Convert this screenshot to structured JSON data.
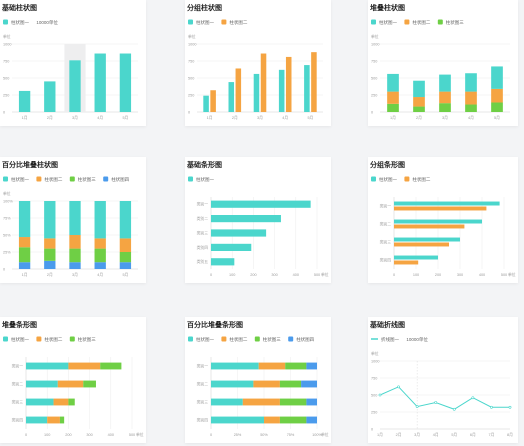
{
  "colors": {
    "teal": "#4bd6cc",
    "orange": "#f5a442",
    "green": "#6fcf45",
    "blue": "#4b9bec",
    "grid": "#ececec",
    "axis": "#cfcfcf",
    "text": "#9a9a9a",
    "highlight": "#eeeeef"
  },
  "chart_data": [
    {
      "id": "c1",
      "type": "bar",
      "title": "基础柱状图",
      "legend": [
        "柱状图一"
      ],
      "legend_note": "10000单位",
      "unit": "单位",
      "yticks": [
        "1000",
        "750",
        "500",
        "250",
        "0"
      ],
      "ymax": 1000,
      "categories": [
        "1月",
        "2月",
        "3月",
        "4月",
        "5月"
      ],
      "highlight_index": 2,
      "series": [
        {
          "name": "柱状图一",
          "color": "teal",
          "values": [
            310,
            450,
            760,
            860,
            860
          ]
        }
      ]
    },
    {
      "id": "c2",
      "type": "bar",
      "title": "分组柱状图",
      "legend": [
        "柱状图一",
        "柱状图二"
      ],
      "unit": "单位",
      "yticks": [
        "1000",
        "750",
        "500",
        "250",
        "0"
      ],
      "ymax": 1000,
      "categories": [
        "1月",
        "2月",
        "3月",
        "4月",
        "5月"
      ],
      "series": [
        {
          "name": "柱状图一",
          "color": "teal",
          "values": [
            240,
            440,
            560,
            620,
            690
          ]
        },
        {
          "name": "柱状图二",
          "color": "orange",
          "values": [
            320,
            640,
            860,
            810,
            880
          ]
        }
      ]
    },
    {
      "id": "c3",
      "type": "stacked-bar",
      "title": "堆叠柱状图",
      "legend": [
        "柱状图一",
        "柱状图二",
        "柱状图三"
      ],
      "unit": "单位",
      "yticks": [
        "1000",
        "750",
        "500",
        "250",
        "0"
      ],
      "ymax": 1000,
      "categories": [
        "1月",
        "2月",
        "3月",
        "4月",
        "5月"
      ],
      "series": [
        {
          "name": "柱状图三",
          "color": "green",
          "values": [
            120,
            80,
            130,
            110,
            140
          ]
        },
        {
          "name": "柱状图二",
          "color": "orange",
          "values": [
            180,
            140,
            170,
            190,
            200
          ]
        },
        {
          "name": "柱状图一",
          "color": "teal",
          "values": [
            260,
            240,
            250,
            270,
            330
          ]
        }
      ]
    },
    {
      "id": "c4",
      "type": "stacked-bar",
      "title": "百分比堆叠柱状图",
      "legend": [
        "柱状图一",
        "柱状图二",
        "柱状图三",
        "柱状图四"
      ],
      "unit": "单位",
      "yticks": [
        "100%",
        "75%",
        "50%",
        "25%",
        "0"
      ],
      "ymax": 100,
      "categories": [
        "1月",
        "2月",
        "3月",
        "4月",
        "5月"
      ],
      "series": [
        {
          "name": "柱状图四",
          "color": "blue",
          "values": [
            10,
            12,
            10,
            10,
            10
          ]
        },
        {
          "name": "柱状图三",
          "color": "green",
          "values": [
            22,
            18,
            20,
            20,
            15
          ]
        },
        {
          "name": "柱状图二",
          "color": "orange",
          "values": [
            15,
            15,
            20,
            15,
            20
          ]
        },
        {
          "name": "柱状图一",
          "color": "teal",
          "values": [
            53,
            55,
            50,
            55,
            55
          ]
        }
      ]
    },
    {
      "id": "c5",
      "type": "hbar",
      "title": "基础条形图",
      "legend": [
        "柱状图一"
      ],
      "unit": "单位",
      "xticks": [
        "0",
        "100",
        "200",
        "300",
        "400",
        "500"
      ],
      "xmax": 500,
      "categories": [
        "类别一",
        "类别二",
        "类别三",
        "类别四",
        "类别五"
      ],
      "series": [
        {
          "name": "柱状图一",
          "color": "teal",
          "values": [
            470,
            330,
            260,
            190,
            110
          ]
        }
      ]
    },
    {
      "id": "c6",
      "type": "hbar",
      "title": "分组条形图",
      "legend": [
        "柱状图一",
        "柱状图二"
      ],
      "unit": "单位",
      "xticks": [
        "0",
        "100",
        "200",
        "300",
        "400",
        "500"
      ],
      "xmax": 500,
      "categories": [
        "类别一",
        "类别二",
        "类别三",
        "类别四"
      ],
      "series": [
        {
          "name": "柱状图一",
          "color": "teal",
          "values": [
            480,
            400,
            300,
            200
          ]
        },
        {
          "name": "柱状图二",
          "color": "orange",
          "values": [
            420,
            320,
            250,
            110
          ]
        }
      ]
    },
    {
      "id": "c7",
      "type": "stacked-hbar",
      "title": "堆叠条形图",
      "legend": [
        "柱状图一",
        "柱状图二",
        "柱状图三"
      ],
      "unit": "单位",
      "xticks": [
        "0",
        "100",
        "200",
        "300",
        "400",
        "500"
      ],
      "xmax": 500,
      "categories": [
        "类别一",
        "类别二",
        "类别三",
        "类别四"
      ],
      "series": [
        {
          "name": "柱状图一",
          "color": "teal",
          "values": [
            200,
            150,
            130,
            100
          ]
        },
        {
          "name": "柱状图二",
          "color": "orange",
          "values": [
            150,
            120,
            70,
            60
          ]
        },
        {
          "name": "柱状图三",
          "color": "green",
          "values": [
            100,
            60,
            30,
            20
          ]
        }
      ]
    },
    {
      "id": "c8",
      "type": "stacked-hbar",
      "title": "百分比堆叠条形图",
      "legend": [
        "柱状图一",
        "柱状图二",
        "柱状图三",
        "柱状图四"
      ],
      "unit": "单位",
      "xticks": [
        "0",
        "25%",
        "50%",
        "75%",
        "100%"
      ],
      "xmax": 100,
      "categories": [
        "类别一",
        "类别二",
        "类别三",
        "类别四"
      ],
      "series": [
        {
          "name": "柱状图一",
          "color": "teal",
          "values": [
            45,
            40,
            30,
            50
          ]
        },
        {
          "name": "柱状图二",
          "color": "orange",
          "values": [
            25,
            25,
            35,
            15
          ]
        },
        {
          "name": "柱状图三",
          "color": "green",
          "values": [
            20,
            20,
            25,
            25
          ]
        },
        {
          "name": "柱状图四",
          "color": "blue",
          "values": [
            10,
            15,
            10,
            10
          ]
        }
      ]
    },
    {
      "id": "c9",
      "type": "line",
      "title": "基础折线图",
      "legend": [
        "折线图一"
      ],
      "legend_note": "10000单位",
      "unit": "单位",
      "yticks": [
        "1000",
        "750",
        "500",
        "250",
        "0"
      ],
      "ymax": 1000,
      "categories": [
        "1月",
        "2月",
        "3月",
        "4月",
        "5月",
        "6月",
        "7月",
        "8月"
      ],
      "series": [
        {
          "name": "折线图一",
          "color": "teal",
          "values": [
            500,
            620,
            330,
            390,
            290,
            460,
            320,
            320
          ]
        }
      ]
    }
  ]
}
